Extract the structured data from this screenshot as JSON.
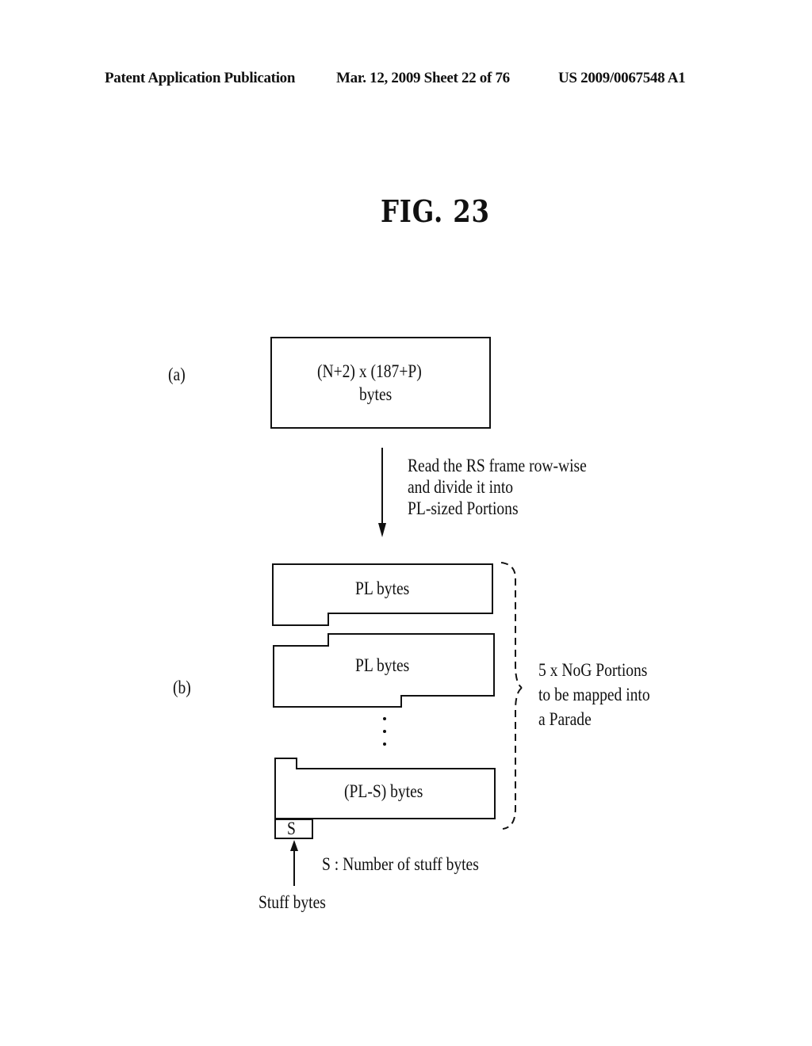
{
  "header": {
    "left": "Patent Application Publication",
    "date_sheet": "Mar. 12, 2009  Sheet 22 of 76",
    "number": "US 2009/0067548 A1"
  },
  "figure": {
    "title": "FIG. 23",
    "part_a": {
      "label": "(a)",
      "box_line1": "(N+2)  x (187+P)",
      "box_line2": "bytes"
    },
    "arrow_note": {
      "line1": "Read the RS frame row-wise",
      "line2": "and divide it into",
      "line3": "PL-sized Portions"
    },
    "part_b": {
      "label": "(b)",
      "portion1": "PL bytes",
      "portion2": "PL bytes",
      "last_portion": "(PL-S) bytes",
      "stuff_box": "S",
      "brace_line1": "5 x NoG Portions",
      "brace_line2": "to be mapped into",
      "brace_line3": "a Parade",
      "legend": "S : Number of stuff bytes",
      "stuff_label": "Stuff bytes"
    }
  }
}
